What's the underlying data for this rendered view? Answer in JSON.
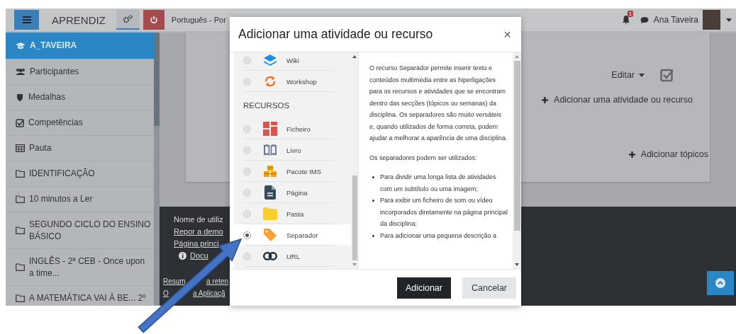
{
  "top_bar": {
    "brand": "APRENDIZ",
    "language": "Português - Por",
    "notification_count": "1",
    "user_name": "Ana Taveira"
  },
  "sidebar": {
    "items": [
      {
        "label": "A_TAVEIRA",
        "selected": true
      },
      {
        "label": "Participantes",
        "selected": false
      },
      {
        "label": "Medalhas",
        "selected": false
      },
      {
        "label": "Competências",
        "selected": false
      },
      {
        "label": "Pauta",
        "selected": false
      },
      {
        "label": "IDENTIFICAÇÃO",
        "selected": false
      },
      {
        "label": "10 minutos a Ler",
        "selected": false
      },
      {
        "label": "SEGUNDO CICLO DO ENSINO BÁSICO",
        "selected": false
      },
      {
        "label": "INGLÊS - 2ª CEB - Once upon a time...",
        "selected": false
      },
      {
        "label": "A MATEMÁTICA VAI À BE... 2º",
        "selected": false
      }
    ]
  },
  "course_section": {
    "edit_label": "Editar",
    "add_activity": "Adicionar uma atividade ou recurso",
    "add_topics": "Adicionar tópicos"
  },
  "footer": {
    "links": [
      {
        "kind": "text",
        "text": "Nome de utiliz"
      },
      {
        "kind": "link",
        "text": "Repor a demo"
      },
      {
        "kind": "link",
        "text": "Página princi"
      },
      {
        "kind": "info-link",
        "text": "Docu"
      }
    ],
    "bottom_links": [
      {
        "segments": [
          "Resum",
          "a reten"
        ]
      },
      {
        "segments": [
          "O",
          "a Aplicaçã"
        ]
      }
    ]
  },
  "dialog": {
    "title": "Adicionar uma atividade ou recurso",
    "close": "×",
    "options": [
      {
        "kind": "option",
        "label": "Wiki",
        "selected": false
      },
      {
        "kind": "option",
        "label": "Workshop",
        "selected": false
      },
      {
        "kind": "heading",
        "label": "RECURSOS"
      },
      {
        "kind": "option",
        "label": "Ficheiro",
        "selected": false
      },
      {
        "kind": "option",
        "label": "Livro",
        "selected": false
      },
      {
        "kind": "option",
        "label": "Pacote IMS",
        "selected": false
      },
      {
        "kind": "option",
        "label": "Página",
        "selected": false
      },
      {
        "kind": "option",
        "label": "Pasta",
        "selected": false
      },
      {
        "kind": "option",
        "label": "Separador",
        "selected": true
      },
      {
        "kind": "option",
        "label": "URL",
        "selected": false
      }
    ],
    "description": {
      "paragraphs": [
        "O recurso Separador permite inserir texto e conteúdos multimédia entre as hiperligações para os recursos e atividades que se encontram dentro das secções (tópicos ou semanas) da disciplina. Os separadores são muito versáteis e, quando utilizados de forma correta, podem ajudar a melhorar a aparência de uma disciplina.",
        "Os separadores podem ser utilizados:"
      ],
      "bullets": [
        "Para dividir uma longa lista de atividades com um subtítulo ou uma imagem;",
        "Para exibir um ficheiro de som ou vídeo incorporados diretamente na página principal da disciplina;",
        "Para adicionar uma pequena descrição a"
      ]
    },
    "buttons": [
      {
        "kind": "primary",
        "label": "Adicionar"
      },
      {
        "kind": "secondary",
        "label": "Cancelar"
      }
    ]
  }
}
